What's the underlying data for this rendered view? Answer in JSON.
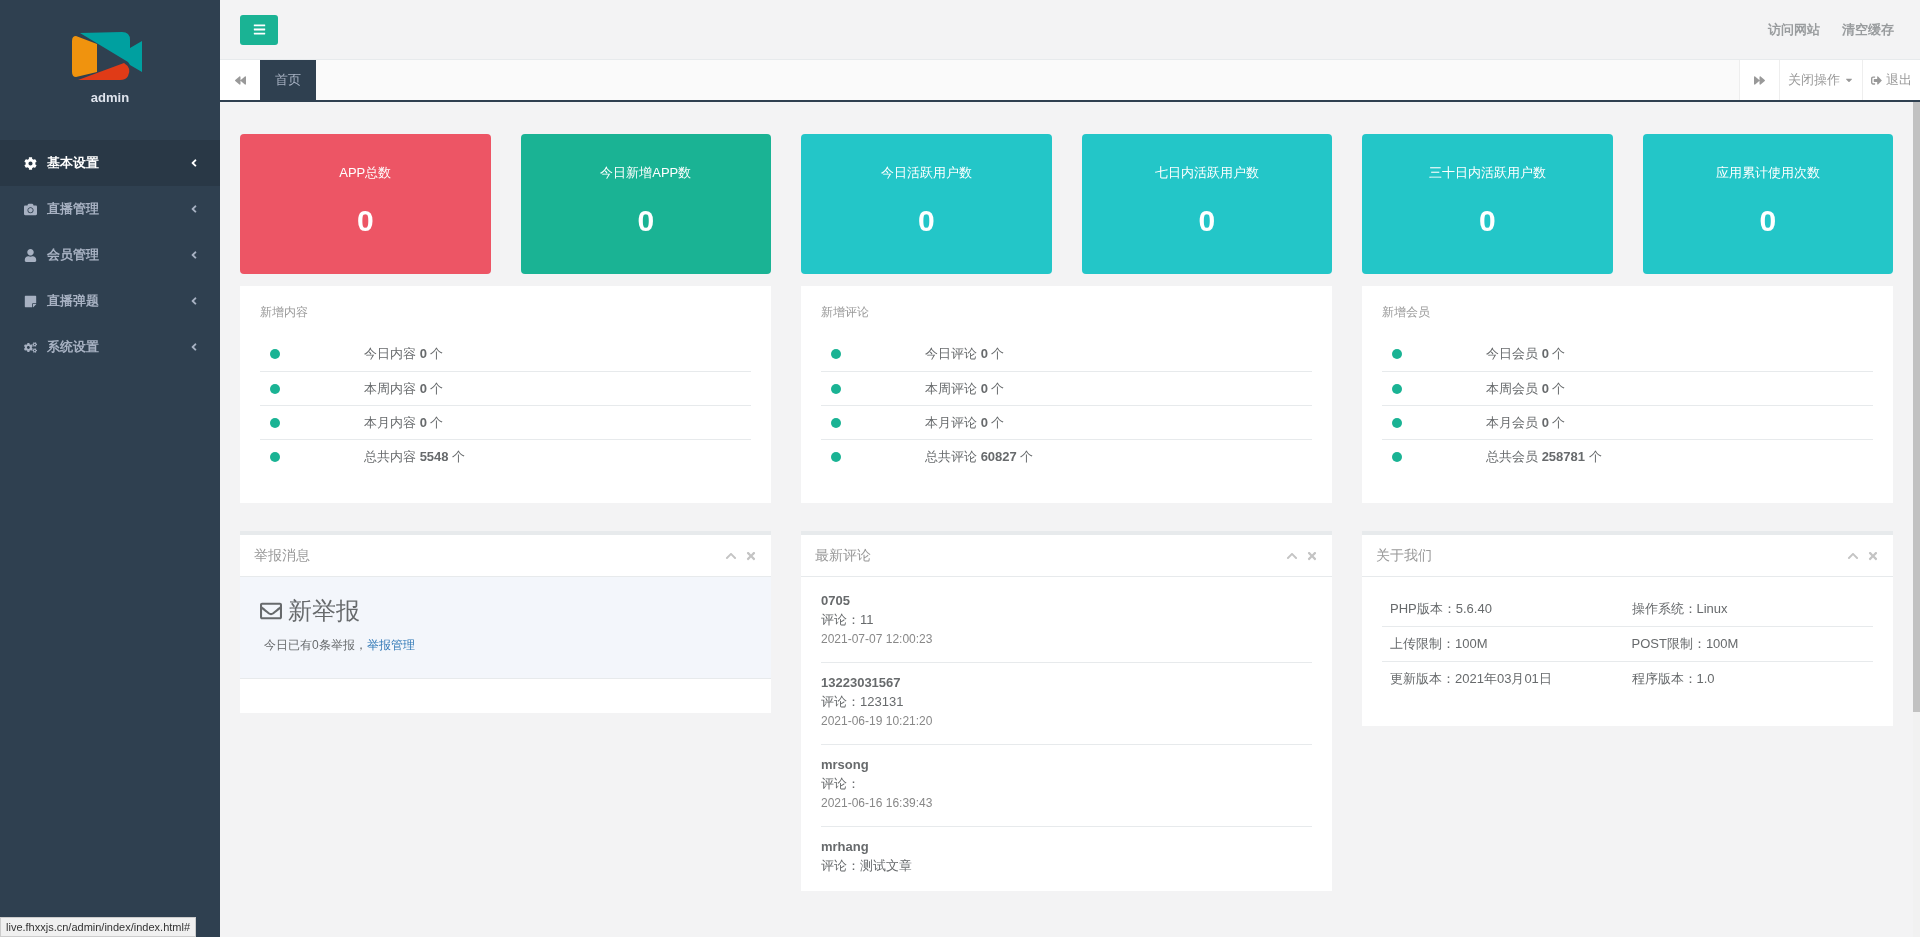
{
  "sidebar": {
    "user": "admin",
    "items": [
      {
        "label": "基本设置",
        "kind": "gear",
        "selected": true
      },
      {
        "label": "直播管理",
        "kind": "camera",
        "selected": false
      },
      {
        "label": "会员管理",
        "kind": "user",
        "selected": false
      },
      {
        "label": "直播弹题",
        "kind": "note",
        "selected": false
      },
      {
        "label": "系统设置",
        "kind": "gears",
        "selected": false
      }
    ]
  },
  "topbar": {
    "links": [
      "访问网站",
      "清空缓存"
    ]
  },
  "tabs": [
    {
      "label": "首页",
      "selected": true
    }
  ],
  "tab_actions": {
    "close_menu": "关闭操作",
    "logout": "退出"
  },
  "stat_cards": [
    {
      "title": "APP总数",
      "value": "0",
      "color": "#ed5565"
    },
    {
      "title": "今日新增APP数",
      "value": "0",
      "color": "#1ab394"
    },
    {
      "title": "今日活跃用户数",
      "value": "0",
      "color": "#23c6c8"
    },
    {
      "title": "七日内活跃用户数",
      "value": "0",
      "color": "#23c6c8"
    },
    {
      "title": "三十日内活跃用户数",
      "value": "0",
      "color": "#23c6c8"
    },
    {
      "title": "应用累计使用次数",
      "value": "0",
      "color": "#23c6c8"
    }
  ],
  "summary_panels": [
    {
      "title": "新增内容",
      "rows": [
        "今日内容 **0** 个",
        "本周内容 **0** 个",
        "本月内容 **0** 个",
        "总共内容 **5548** 个"
      ]
    },
    {
      "title": "新增评论",
      "rows": [
        "今日评论 **0** 个",
        "本周评论 **0** 个",
        "本月评论 **0** 个",
        "总共评论 **60827** 个"
      ]
    },
    {
      "title": "新增会员",
      "rows": [
        "今日会员 **0** 个",
        "本周会员 **0** 个",
        "本月会员 **0** 个",
        "总共会员 **258781** 个"
      ]
    }
  ],
  "report_panel": {
    "title": "举报消息",
    "headline": "新举报",
    "text": "今日已有0条举报，",
    "link": "举报管理"
  },
  "comments_panel": {
    "title": "最新评论",
    "items": [
      {
        "user": "0705",
        "comment": "评论：11",
        "time": "2021-07-07 12:00:23"
      },
      {
        "user": "13223031567",
        "comment": "评论：123131",
        "time": "2021-06-19 10:21:20"
      },
      {
        "user": "mrsong",
        "comment": "评论：",
        "time": "2021-06-16 16:39:43"
      },
      {
        "user": "mrhang",
        "comment": "评论：测试文章"
      }
    ]
  },
  "about_panel": {
    "title": "关于我们",
    "rows": [
      [
        "PHP版本：5.6.40",
        "操作系统：Linux"
      ],
      [
        "上传限制：100M",
        "POST限制：100M"
      ],
      [
        "更新版本：2021年03月01日",
        "程序版本：1.0"
      ]
    ]
  },
  "status_bar": "live.fhxxjs.cn/admin/index/index.html#"
}
